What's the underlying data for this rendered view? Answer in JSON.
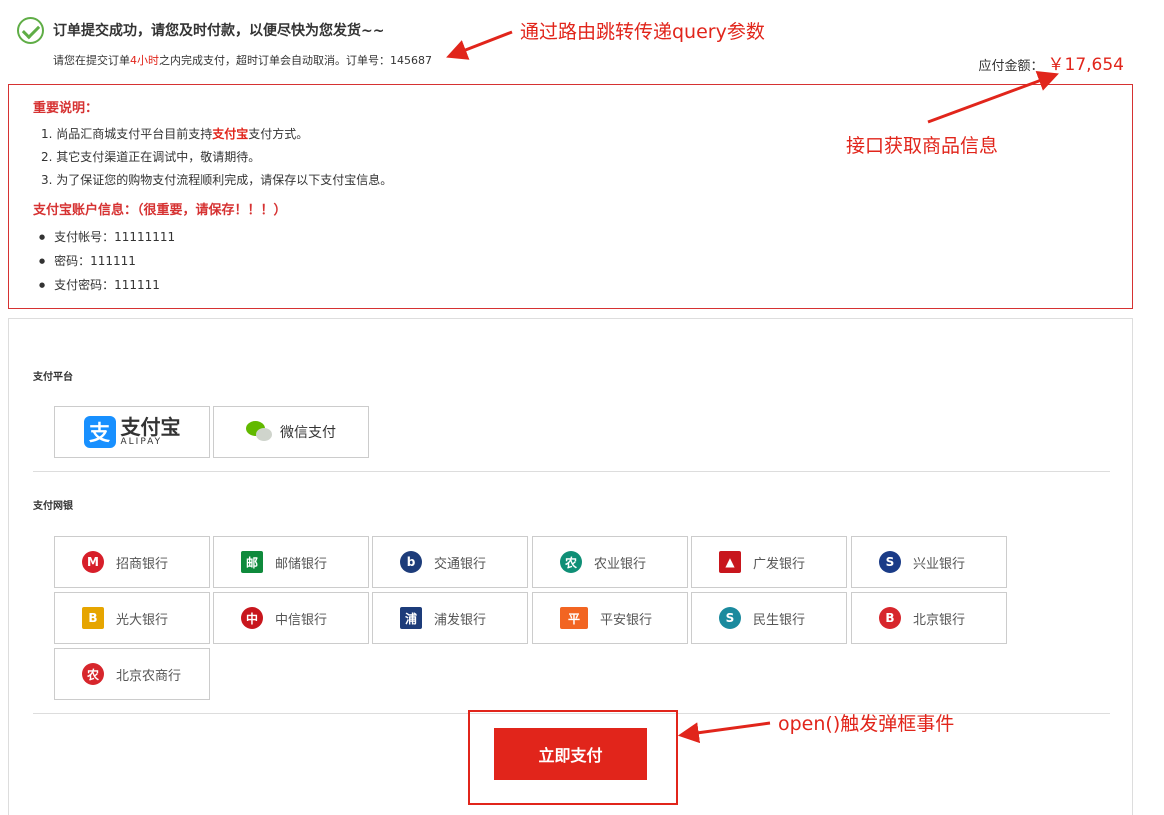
{
  "header": {
    "success_title": "订单提交成功，请您及时付款，以便尽快为您发货~~",
    "sub_pre": "请您在提交订单",
    "sub_hours": "4小时",
    "sub_mid": "之内完成支付，超时订单会自动取消。订单号：",
    "order_no": "145687",
    "amount_label": "应付金额：",
    "amount_value": "￥17,654"
  },
  "notice": {
    "title": "重要说明：",
    "item1_pre": "1. 尚品汇商城支付平台目前支持",
    "item1_highlight": "支付宝",
    "item1_post": "支付方式。",
    "item2": "2. 其它支付渠道正在调试中，敬请期待。",
    "item3": "3. 为了保证您的购物支付流程顺利完成，请保存以下支付宝信息。",
    "alipay_title": "支付宝账户信息：（很重要，请保存！！！）",
    "account_items": [
      "支付帐号：11111111",
      "密码：111111",
      "支付密码：111111"
    ]
  },
  "payment": {
    "platform_label": "支付平台",
    "alipay_cn": "支付宝",
    "alipay_en": "ALIPAY",
    "wechat_label": "微信支付",
    "bank_label": "支付网银",
    "banks": [
      "招商银行",
      "邮储银行",
      "交通银行",
      "农业银行",
      "广发银行",
      "兴业银行",
      "光大银行",
      "中信银行",
      "浦发银行",
      "平安银行",
      "民生银行",
      "北京银行",
      "北京农商行"
    ],
    "pay_button": "立即支付"
  },
  "annotations": {
    "a1": "通过路由跳转传递query参数",
    "a2": "接口获取商品信息",
    "a3": "open()触发弹框事件"
  },
  "colors": {
    "accent_red": "#e1251b",
    "success_green": "#5fad46",
    "alipay_blue": "#1890ff"
  }
}
